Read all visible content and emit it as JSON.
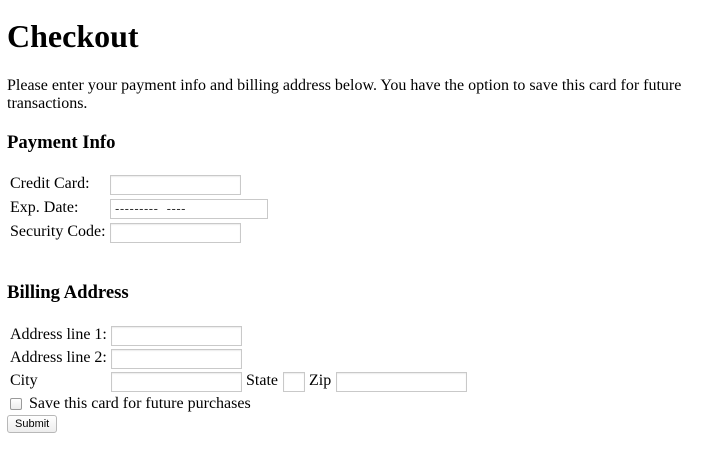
{
  "page": {
    "title": "Checkout",
    "intro": "Please enter your payment info and billing address below. You have the option to save this card for future transactions."
  },
  "payment": {
    "heading": "Payment Info",
    "credit_card_label": "Credit Card:",
    "credit_card_value": "",
    "exp_date_label": "Exp. Date:",
    "exp_date_placeholder": "---------  ----",
    "security_code_label": "Security Code:",
    "security_code_value": ""
  },
  "billing": {
    "heading": "Billing Address",
    "address1_label": "Address line 1:",
    "address1_value": "",
    "address2_label": "Address line 2:",
    "address2_value": "",
    "city_label": "City",
    "city_value": "",
    "state_label": "State",
    "state_value": "",
    "zip_label": "Zip",
    "zip_value": "",
    "save_card_label": "Save this card for future purchases",
    "save_card_checked": false
  },
  "actions": {
    "submit_label": "Submit"
  }
}
